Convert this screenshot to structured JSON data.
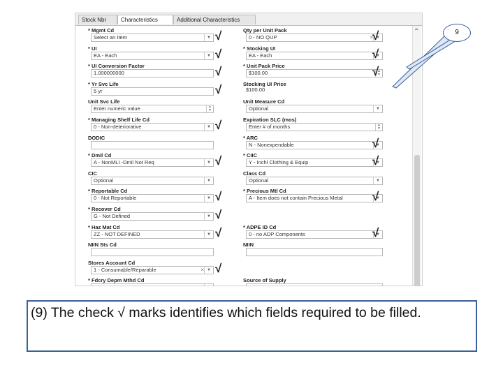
{
  "tabs": [
    "Stock Nbr",
    "Characteristics",
    "Additional Characteristics"
  ],
  "fields": [
    {
      "label": "* Mgmt Cd",
      "value": "Select an Item",
      "kind": "select",
      "checked": true
    },
    {
      "label": "Qty per Unit Pack",
      "value": "0 - NO QUP",
      "kind": "select-clear",
      "checked": true
    },
    {
      "label": "* UI",
      "value": "EA - Each",
      "kind": "select",
      "checked": true
    },
    {
      "label": "* Stocking UI",
      "value": "EA - Each",
      "kind": "select",
      "checked": true
    },
    {
      "label": "* UI Conversion Factor",
      "value": "1.000000000",
      "kind": "text",
      "checked": true
    },
    {
      "label": "* Unit Pack Price",
      "value": "$100.00",
      "kind": "spin",
      "checked": true
    },
    {
      "label": "* Yr Svc Life",
      "value": "5 yr",
      "kind": "text",
      "checked": true
    },
    {
      "label": "Stocking UI Price",
      "value": "$100.00",
      "kind": "plain",
      "checked": false
    },
    {
      "label": "Unit Svc Life",
      "value": "Enter numeric value",
      "kind": "spin",
      "checked": false
    },
    {
      "label": "Unit Measure Cd",
      "value": "Optional",
      "kind": "select",
      "checked": false
    },
    {
      "label": "* Managing Shelf Life Cd",
      "value": "0 - Non-deteriorative",
      "kind": "select",
      "checked": true
    },
    {
      "label": "Expiration SLC (mos)",
      "value": "Enter # of months",
      "kind": "spin",
      "checked": false
    },
    {
      "label": "DODIC",
      "value": "",
      "kind": "text",
      "checked": false
    },
    {
      "label": "* ARC",
      "value": "N - Nonexpendable",
      "kind": "select",
      "checked": true
    },
    {
      "label": "* Dmil Cd",
      "value": "A - NonMLI  -Dmil Not Req",
      "kind": "select",
      "checked": true
    },
    {
      "label": "* CIIC",
      "value": "Y - Inchl Clothing & Equip",
      "kind": "select",
      "checked": true
    },
    {
      "label": "CIC",
      "value": "Optional",
      "kind": "select",
      "checked": false
    },
    {
      "label": "Class Cd",
      "value": "Optional",
      "kind": "select",
      "checked": false
    },
    {
      "label": "* Reportable Cd",
      "value": "0 - Not Reportable",
      "kind": "select",
      "checked": true
    },
    {
      "label": "* Precious Mtl Cd",
      "value": "A - Item does not contain Precious Metal",
      "kind": "select",
      "checked": true
    },
    {
      "label": "* Recover Cd",
      "value": "G - Not Defined",
      "kind": "select",
      "checked": true
    },
    {
      "label": "",
      "value": "",
      "kind": "none",
      "checked": false
    },
    {
      "label": "* Haz Mat Cd",
      "value": "ZZ - NOT DEFINED",
      "kind": "select",
      "checked": true
    },
    {
      "label": "* ADPE ID Cd",
      "value": "0 - no ADP Components",
      "kind": "select",
      "checked": true
    },
    {
      "label": "NIIN Sts Cd",
      "value": "",
      "kind": "text",
      "checked": false
    },
    {
      "label": "NIIN",
      "value": "",
      "kind": "text",
      "checked": false
    },
    {
      "label": "Stores Account Cd",
      "value": "1 - Consumable/Reparable",
      "kind": "select-clear",
      "checked": true
    },
    {
      "label": "",
      "value": "",
      "kind": "none",
      "checked": false
    },
    {
      "label": "* Fdcry Depm Mthd Cd",
      "value": "",
      "kind": "select",
      "checked": false
    },
    {
      "label": "Source of Supply",
      "value": "",
      "kind": "text",
      "checked": false
    }
  ],
  "callout": {
    "badge": "9",
    "text": "(9) The check √ marks  identifies which fields required to be filled."
  },
  "check_glyph": "√",
  "colors": {
    "callout_border": "#3a5f9a"
  }
}
